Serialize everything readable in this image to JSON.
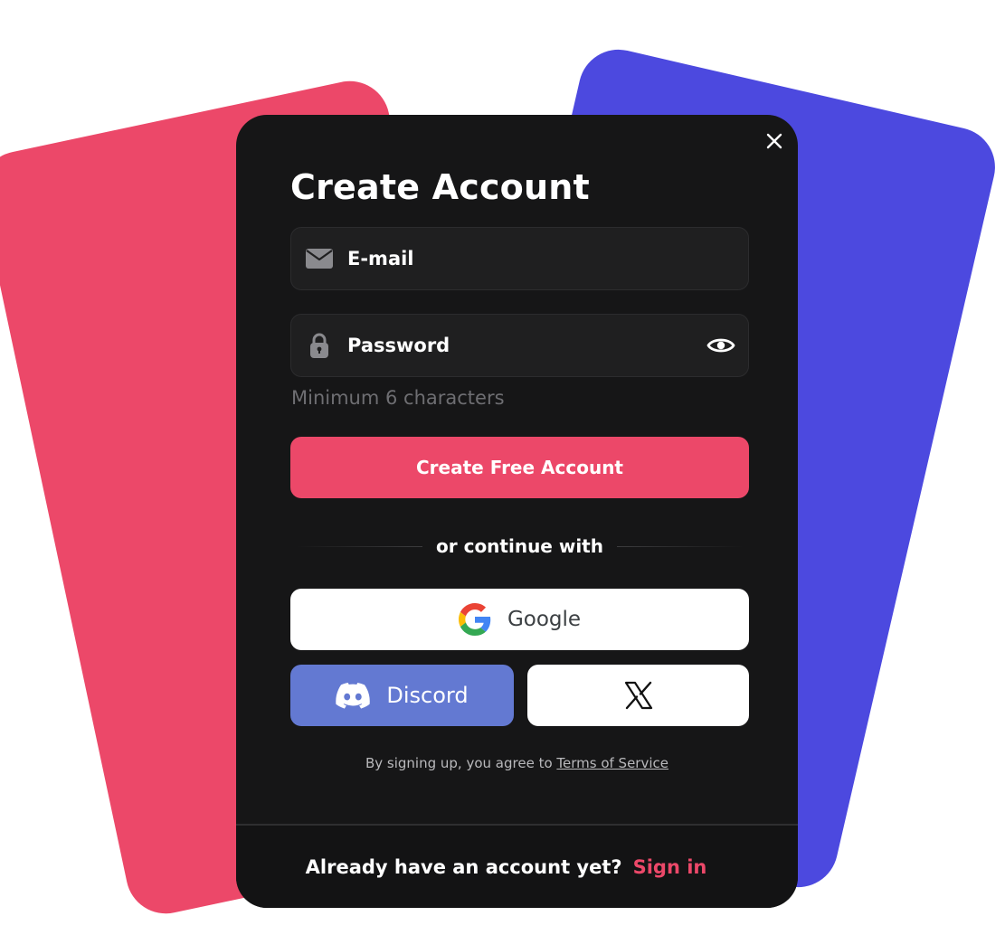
{
  "colors": {
    "pink_accent": "#ec4869",
    "blue_accent": "#4c49df",
    "modal_bg": "#161617",
    "field_bg": "#1f1f20",
    "discord": "#6379d2"
  },
  "modal": {
    "title": "Create Account",
    "close_icon": "close-icon"
  },
  "form": {
    "email": {
      "placeholder": "E-mail",
      "value": "",
      "icon": "mail-icon"
    },
    "password": {
      "placeholder": "Password",
      "value": "",
      "icon": "lock-icon",
      "toggle_icon": "eye-icon"
    },
    "hint": "Minimum 6 characters",
    "submit_label": "Create Free Account"
  },
  "divider": {
    "text": "or continue with"
  },
  "social": {
    "google_label": "Google",
    "google_icon": "google-icon",
    "discord_label": "Discord",
    "discord_icon": "discord-icon",
    "x_icon": "x-icon"
  },
  "terms": {
    "prefix": "By signing up, you agree to ",
    "link_label": "Terms of Service"
  },
  "footer": {
    "text": "Already have an account yet?",
    "link_label": "Sign in"
  }
}
